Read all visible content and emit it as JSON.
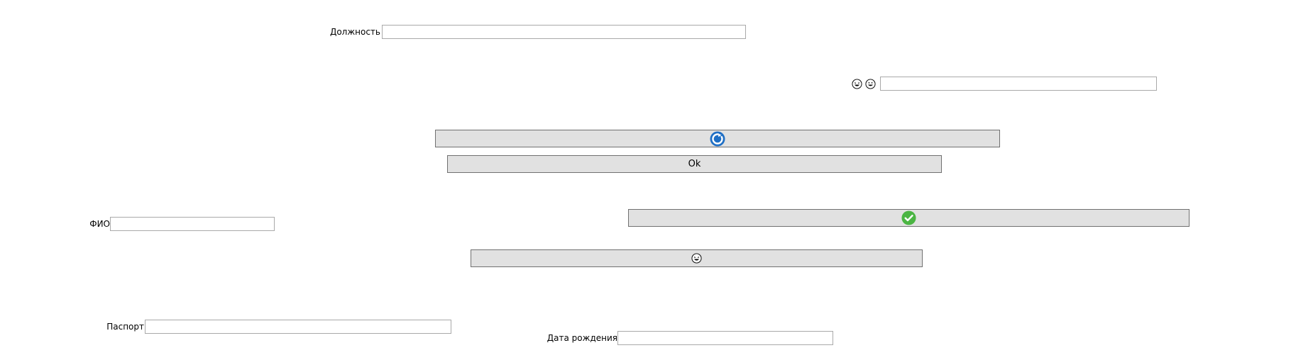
{
  "form": {
    "position_label": "Должность",
    "position_value": "",
    "emoji_field_value": "",
    "fio_label": "ФИО",
    "fio_value": "",
    "passport_label": "Паспорт",
    "passport_value": "",
    "birth_date_label": "Дата рождения",
    "birth_date_value": ""
  },
  "buttons": {
    "ok_label": "Ok"
  },
  "colors": {
    "button_face": "#e1e1e1",
    "button_border": "#707070",
    "field_border": "#a9a9a9",
    "refresh_icon_blue": "#1f6fc5",
    "check_icon_green": "#4bb543"
  },
  "icons": {
    "emoji_field_icons": [
      "laughing-face-icon",
      "grinning-face-icon"
    ],
    "top_button_icon": "blue-refresh-icon",
    "check_button_icon": "green-check-icon",
    "emoji_button_icon": "laughing-face-icon"
  }
}
